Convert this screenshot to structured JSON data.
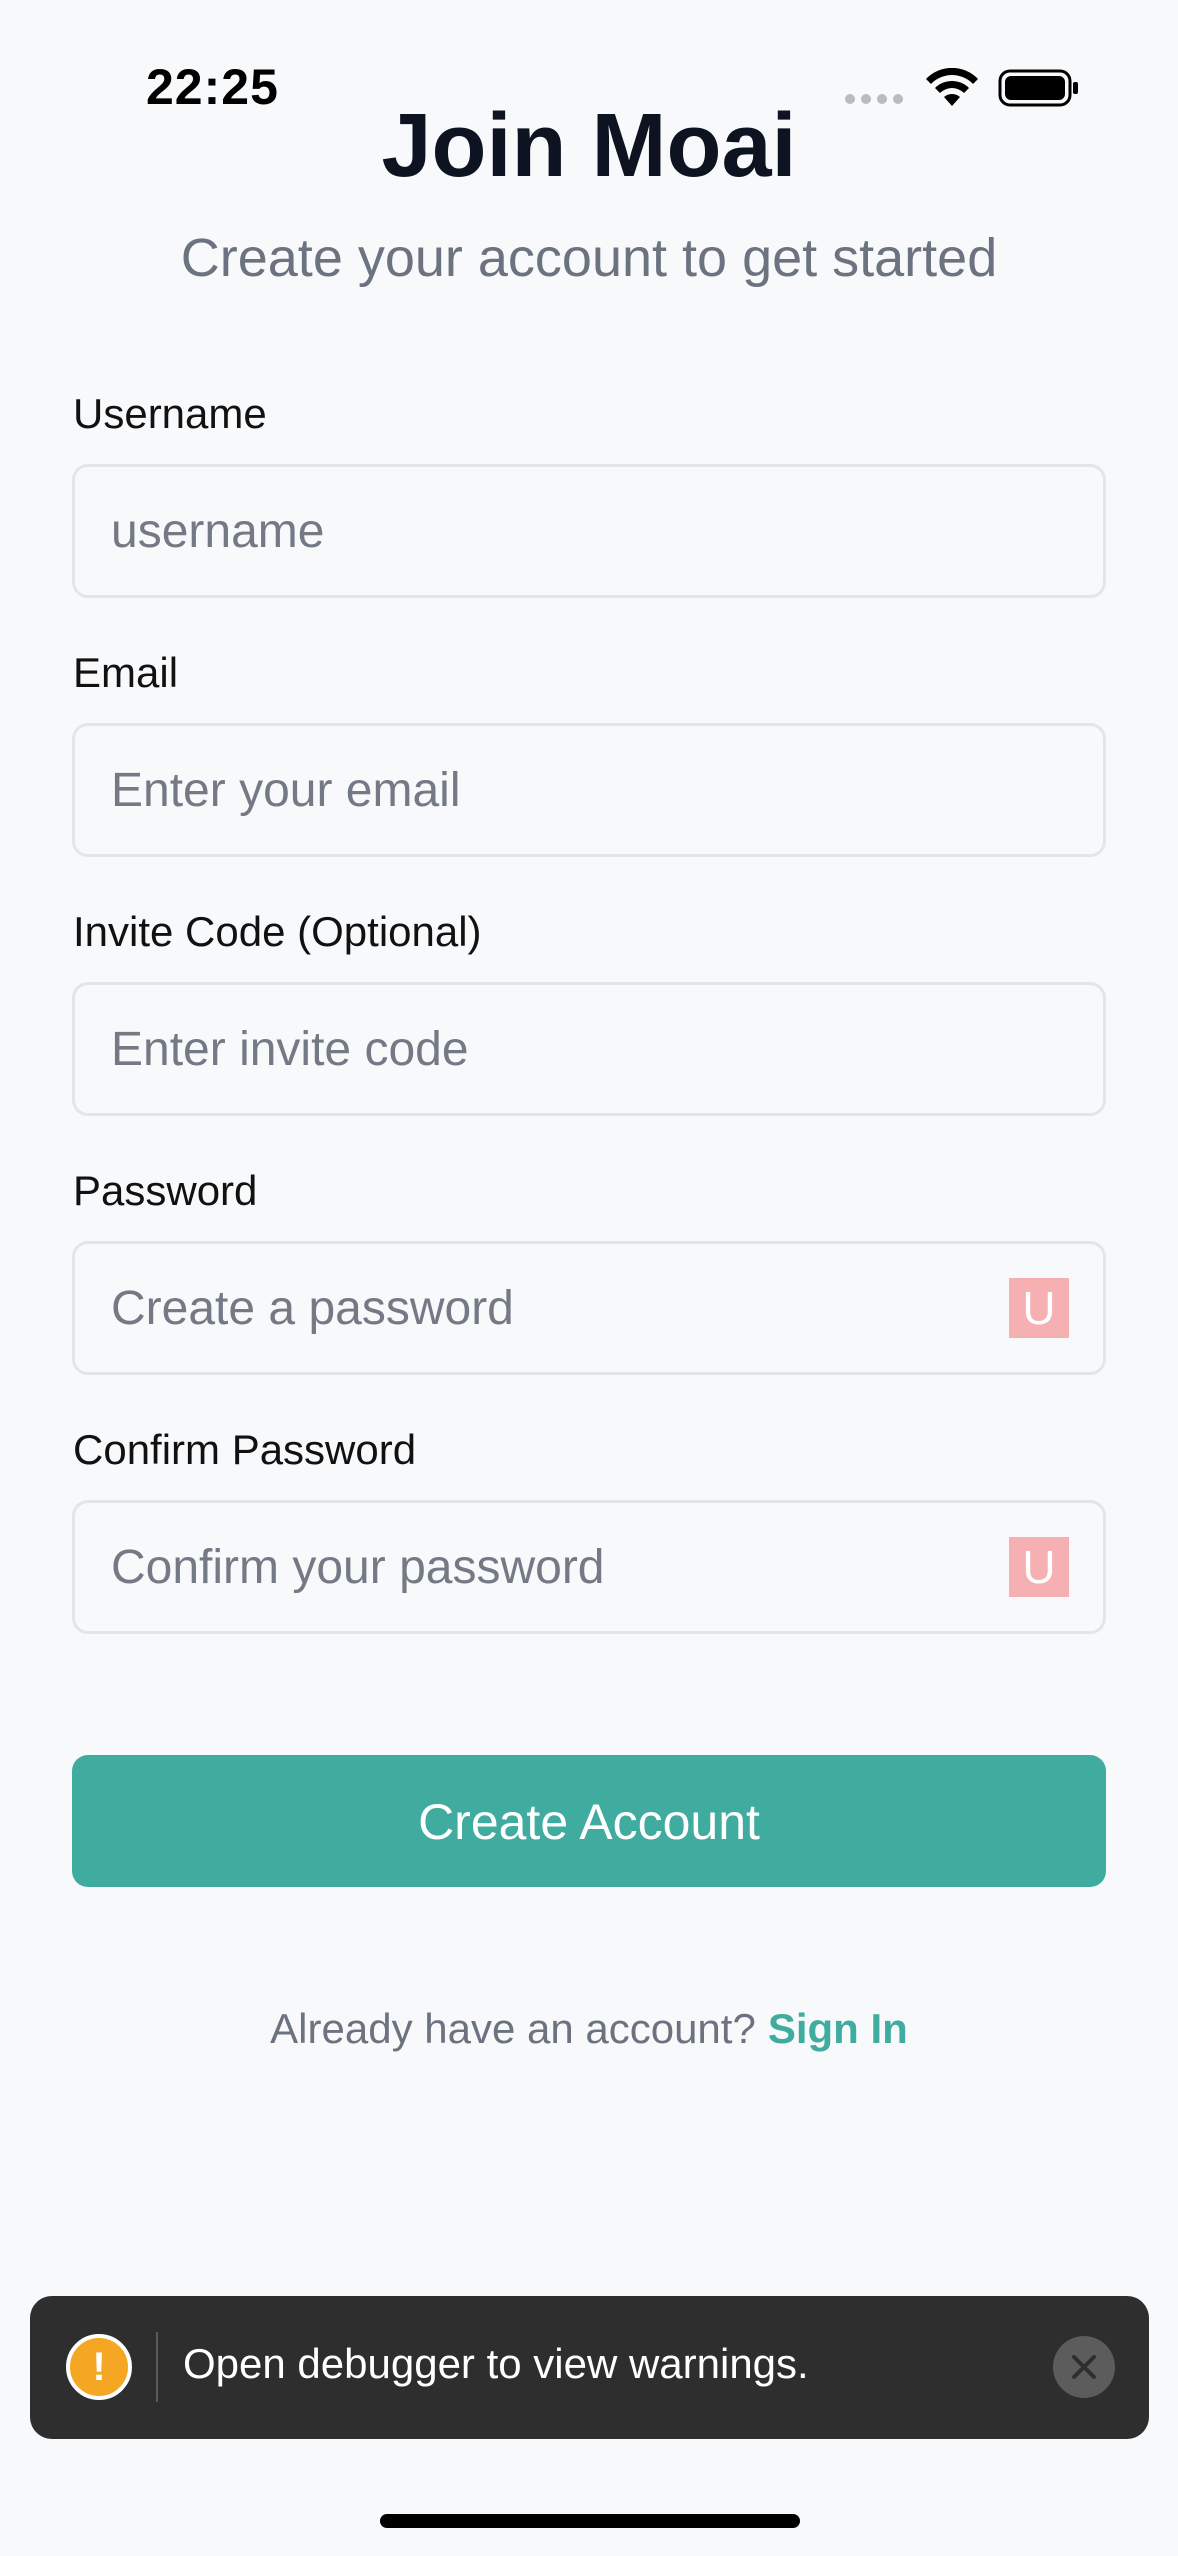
{
  "status_bar": {
    "time": "22:25"
  },
  "header": {
    "title": "Join Moai",
    "subtitle": "Create your account to get started"
  },
  "form": {
    "username": {
      "label": "Username",
      "placeholder": "username",
      "value": ""
    },
    "email": {
      "label": "Email",
      "placeholder": "Enter your email",
      "value": ""
    },
    "invite_code": {
      "label": "Invite Code (Optional)",
      "placeholder": "Enter invite code",
      "value": ""
    },
    "password": {
      "label": "Password",
      "placeholder": "Create a password",
      "value": "",
      "toggle_glyph": "U"
    },
    "confirm_password": {
      "label": "Confirm Password",
      "placeholder": "Confirm your password",
      "value": "",
      "toggle_glyph": "U"
    },
    "submit_label": "Create Account"
  },
  "footer": {
    "prompt": "Already have an account?",
    "link": "Sign In"
  },
  "toast": {
    "icon_glyph": "!",
    "message": "Open debugger to view warnings."
  },
  "colors": {
    "accent": "#40ab9f",
    "background": "#f8f9fb",
    "toast_background": "#2e2e2e",
    "warning": "#f5a623"
  },
  "icons": {
    "wifi": "wifi-icon",
    "battery": "battery-icon",
    "signal": "cellular-signal-icon",
    "warning": "warning-icon",
    "close": "close-icon",
    "password_toggle": "eye-toggle-icon"
  }
}
